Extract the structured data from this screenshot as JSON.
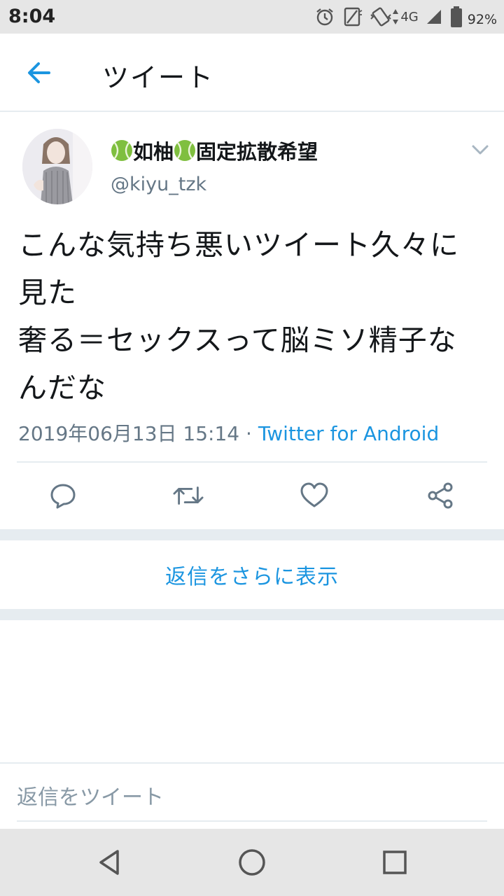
{
  "status_bar": {
    "time": "8:04",
    "network": "4G",
    "battery_percent": "92%",
    "icons": [
      "alarm-icon",
      "rotate-icon",
      "vibrate-icon",
      "signal-icon",
      "battery-icon"
    ]
  },
  "header": {
    "title": "ツイート",
    "back_icon": "arrow-left-icon",
    "accent_color": "#1b95e0"
  },
  "tweet": {
    "display_name": "如柚",
    "display_name_suffix": "固定拡散希望",
    "name_emoji": "tennis-ball-icon",
    "handle": "@kiyu_tzk",
    "text_lines": [
      "こんな気持ち悪いツイート久々に",
      "見た",
      "奢る＝セックスって脳ミソ精子な",
      "んだな"
    ],
    "timestamp": "2019年06月13日 15:14",
    "separator": " · ",
    "source": "Twitter for Android",
    "actions": [
      "reply-icon",
      "retweet-icon",
      "like-icon",
      "share-icon"
    ]
  },
  "more_replies_label": "返信をさらに表示",
  "compose_placeholder": "返信をツイート",
  "nav": [
    "back-triangle-icon",
    "home-circle-icon",
    "recents-square-icon"
  ]
}
